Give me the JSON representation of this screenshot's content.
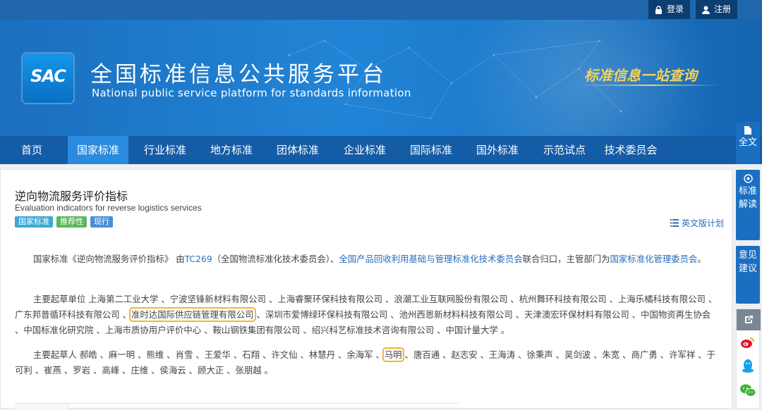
{
  "header": {
    "login_label": "登录",
    "register_label": "注册",
    "logo_text": "SAC",
    "title": "全国标准信息公共服务平台",
    "subtitle": "National public service platform  for standards information",
    "slogan": "标准信息一站查询"
  },
  "nav": {
    "items": [
      {
        "label": "首页"
      },
      {
        "label": "国家标准",
        "active": true
      },
      {
        "label": "行业标准"
      },
      {
        "label": "地方标准"
      },
      {
        "label": "团体标准"
      },
      {
        "label": "企业标准"
      },
      {
        "label": "国际标准"
      },
      {
        "label": "国外标准"
      },
      {
        "label": "示范试点"
      },
      {
        "label": "技术委员会"
      }
    ]
  },
  "standard": {
    "title_cn": "逆向物流服务评价指标",
    "title_en": "Evaluation indicators for reverse logistics services",
    "tags": [
      {
        "label": "国家标准",
        "color": "#3aa9d6"
      },
      {
        "label": "推荐性",
        "color": "#5cb85c"
      },
      {
        "label": "现行",
        "color": "#4a90d9"
      }
    ],
    "en_plan_label": "英文版计划"
  },
  "para1": {
    "p1": "国家标准《逆向物流服务评价指标》 由",
    "tc_link": "TC269",
    "p2": "（全国物流标准化技术委员会）、",
    "link2": "全国产品回收利用基础与管理标准化技术委员会",
    "p3": "联合归口，主管部门为",
    "link3": "国家标准化管理委员会",
    "p4": "。"
  },
  "para2": {
    "prefix": "主要起草单位 上海第二工业大学 、宁波坚锋新材料有限公司 、上海睿聚环保科技有限公司 、浪潮工业互联网股份有限公司 、杭州舞环科技有限公司 、上海乐橘科技有限公司 、广东邦普循环科技有限公司 、",
    "highlight": "准时达国际供应链管理有限公司",
    "suffix": " 、深圳市爱博绿环保科技有限公司 、池州西恩新材料科技有限公司 、天津澳宏环保材料有限公司 、中国物资再生协会 、中国标准化研究院 、上海市质协用户评价中心 、鞍山钢铁集团有限公司 、绍兴科艺标准技术咨询有限公司 、中国计量大学 。"
  },
  "para3": {
    "prefix": "主要起草人 郝皓 、麻一明 、熊维 、肖雪 、王爱华 、石翔 、许文仙 、林慧丹 、余海军 、",
    "highlight": "马明",
    "suffix": " 、唐百通 、赵志安 、王海涛 、徐秉声 、吴剑波 、朱宽 、商广勇 、许军祥 、于可利 、崔燕 、罗岩 、高峰 、庄维 、侯海云 、顾大正 、张朋越 。"
  },
  "sidebar": {
    "full_text": "全文",
    "interpret": "标准解读",
    "feedback": "意见建议"
  }
}
